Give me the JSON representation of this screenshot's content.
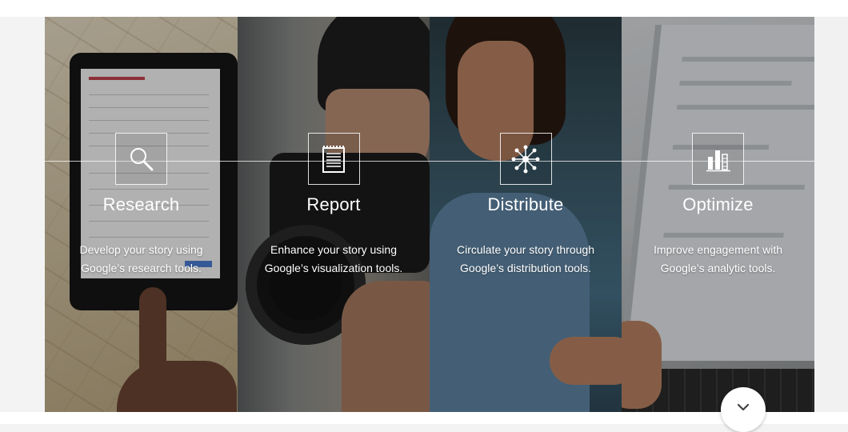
{
  "features": [
    {
      "title": "Research",
      "icon": "magnifier-icon",
      "desc_line1": "Develop your story using",
      "desc_line2": "Google’s research tools."
    },
    {
      "title": "Report",
      "icon": "notepad-icon",
      "desc_line1": "Enhance your story using",
      "desc_line2": "Google’s visualization tools."
    },
    {
      "title": "Distribute",
      "icon": "network-icon",
      "desc_line1": "Circulate your story through",
      "desc_line2": "Google’s distribution tools."
    },
    {
      "title": "Optimize",
      "icon": "bar-chart-icon",
      "desc_line1": "Improve engagement with",
      "desc_line2": "Google’s analytic tools."
    }
  ],
  "scroll_button": {
    "icon": "chevron-down-icon"
  },
  "colors": {
    "text": "#ffffff",
    "page_background": "#f3f3f3"
  }
}
